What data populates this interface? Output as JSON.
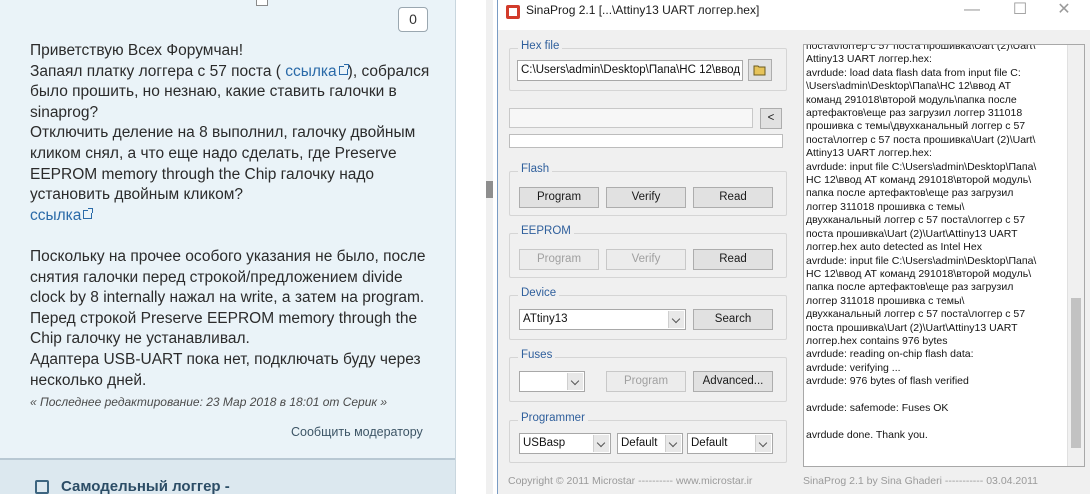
{
  "forum": {
    "counter": "0",
    "post_lines": [
      "Приветствую Всех Форумчан!",
      "Запаял платку логгера с 57 поста (",
      "было прошить, но незнаю, какие ставить галочки в",
      "sinaprog?",
      "Отключить деление на 8 выполнил, галочку двойным",
      "кликом снял, а что еще надо сделать, где Preserve",
      "EEPROM memory through the Chip галочку надо",
      "установить двойным кликом?",
      "Поскольку на прочее особого указания не было, после",
      "снятия галочки перед строкой/предложением divide",
      "clock by 8 internally нажал на write, а затем на program.",
      "Перед строкой  Preserve EEPROM memory through the",
      "Chip галочку не устанавливал.",
      "Адаптера USB-UART пока нет, подключать буду через",
      "несколько дней."
    ],
    "link_label": "ссылка",
    "line2_tail": "), собрался",
    "edited_note": "« Последнее редактирование: 23 Мар 2018 в 18:01 от Серик »",
    "report_label": "Сообщить модератору",
    "next_topic": "Самодельный логгер -"
  },
  "window": {
    "title": "SinaProg 2.1 [...\\Attiny13 UART логгер.hex]",
    "hex_legend": "Hex file",
    "hex_path": "C:\\Users\\admin\\Desktop\\Папа\\НС 12\\ввод",
    "flash_legend": "Flash",
    "eeprom_legend": "EEPROM",
    "device_legend": "Device",
    "fuses_legend": "Fuses",
    "programmer_legend": "Programmer",
    "buttons": {
      "program": "Program",
      "verify": "Verify",
      "read": "Read",
      "search": "Search",
      "advanced": "Advanced...",
      "back": "<"
    },
    "device_value": "ATtiny13",
    "fuses_value": "",
    "programmer_value": "USBasp",
    "port_value": "Default",
    "speed_value": "Default",
    "status_left": "Copyright © 2011 Microstar  ----------  www.microstar.ir",
    "status_right": "SinaProg 2.1  by  Sina Ghaderi  -----------  03.04.2011",
    "log_lines": [
      "поста\\логгер с 57 поста прошивка\\Uart (2)\\Uart\\",
      "Attiny13 UART логгер.hex:",
      "avrdude: load data flash data from input file C:",
      "\\Users\\admin\\Desktop\\Папа\\НС 12\\ввод АТ",
      "команд 291018\\второй модуль\\папка после",
      "артефактов\\еще раз загрузил логгер 311018",
      "прошивка с темы\\двухканальный логгер с 57",
      "поста\\логгер с 57 поста прошивка\\Uart (2)\\Uart\\",
      "Attiny13 UART логгер.hex:",
      "avrdude: input file C:\\Users\\admin\\Desktop\\Папа\\",
      "НС 12\\ввод АТ команд 291018\\второй модуль\\",
      "папка после артефактов\\еще раз загрузил",
      "логгер 311018 прошивка с темы\\",
      "двухканальный логгер с 57 поста\\логгер с 57",
      "поста прошивка\\Uart (2)\\Uart\\Attiny13 UART",
      "логгер.hex auto detected as Intel Hex",
      "avrdude: input file C:\\Users\\admin\\Desktop\\Папа\\",
      "НС 12\\ввод АТ команд 291018\\второй модуль\\",
      "папка после артефактов\\еще раз загрузил",
      "логгер 311018 прошивка с темы\\",
      "двухканальный логгер с 57 поста\\логгер с 57",
      "поста прошивка\\Uart (2)\\Uart\\Attiny13 UART",
      "логгер.hex contains 976 bytes",
      "avrdude: reading on-chip flash data:",
      "avrdude: verifying ...",
      "avrdude: 976 bytes of flash verified",
      "",
      "avrdude: safemode: Fuses OK",
      "",
      "avrdude done.  Thank you."
    ]
  }
}
